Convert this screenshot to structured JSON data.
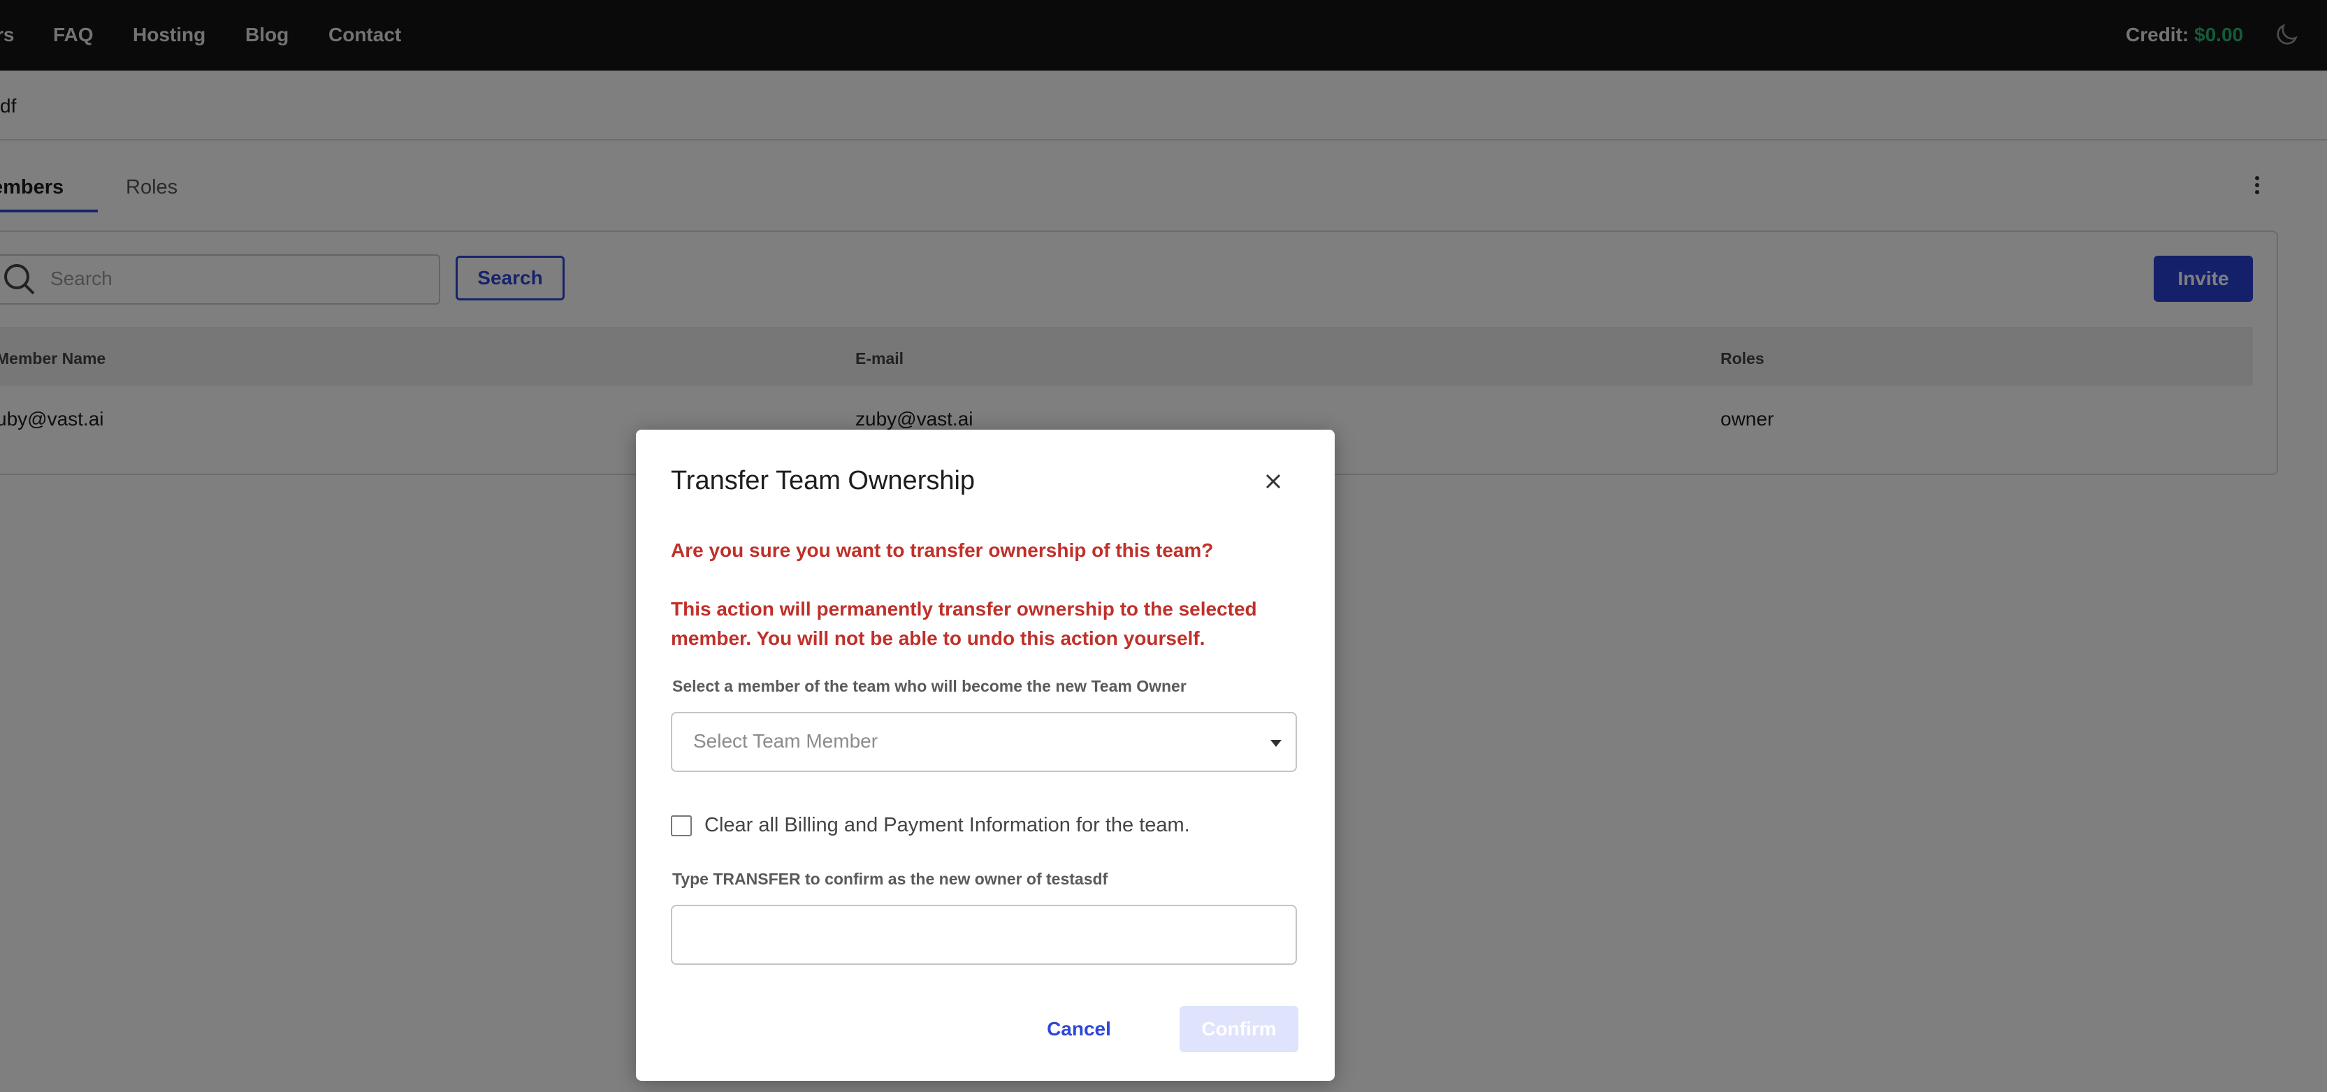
{
  "nav": {
    "partial_link": "rs",
    "links": [
      "FAQ",
      "Hosting",
      "Blog",
      "Contact"
    ],
    "credit_label": "Credit:",
    "credit_amount": "$0.00"
  },
  "team": {
    "name_partial": "sdf"
  },
  "tabs": {
    "members": "embers",
    "roles": "Roles"
  },
  "toolbar": {
    "search_placeholder": "Search",
    "search_button": "Search",
    "invite_button": "Invite"
  },
  "table": {
    "headers": [
      "Member Name",
      "E-mail",
      "Roles"
    ],
    "rows": [
      {
        "name": "uby@vast.ai",
        "email": "zuby@vast.ai",
        "role": "owner"
      }
    ]
  },
  "modal": {
    "title": "Transfer Team Ownership",
    "warning_1": "Are you sure you want to transfer ownership of this team?",
    "warning_2": "This action will permanently transfer ownership to the selected member. You will not be able to undo this action yourself.",
    "select_label": "Select a member of the team who will become the new Team Owner",
    "select_placeholder": "Select Team Member",
    "checkbox_label": "Clear all Billing and Payment Information for the team.",
    "confirm_label": "Type TRANSFER to confirm as the new owner of testasdf",
    "confirm_input_value": "",
    "cancel_button": "Cancel",
    "confirm_button": "Confirm"
  },
  "colors": {
    "accent": "#2e47d6",
    "warning": "#c0302a",
    "credit": "#2bb673"
  }
}
